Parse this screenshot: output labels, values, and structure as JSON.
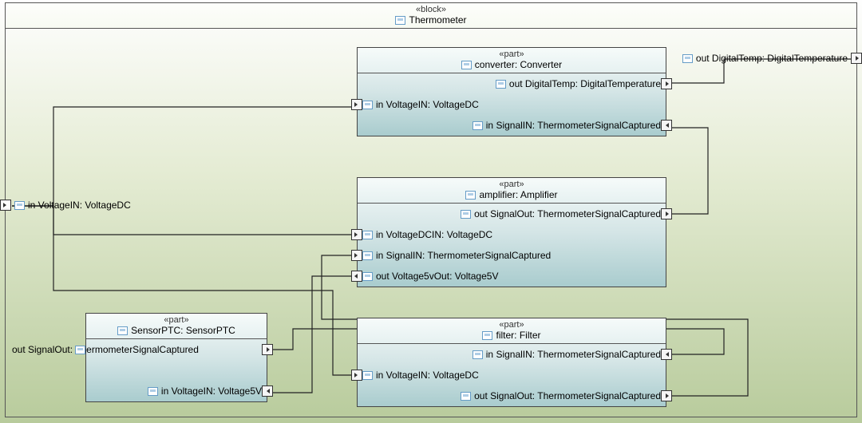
{
  "block": {
    "stereotype": "«block»",
    "name": "Thermometer",
    "outer_ports": {
      "voltageIn": {
        "label": "in VoltageIN: VoltageDC",
        "direction": "in",
        "side": "left"
      },
      "digitalTempOut": {
        "label": "out DigitalTemp: DigitalTemperature",
        "direction": "out",
        "side": "right"
      }
    }
  },
  "parts": {
    "converter": {
      "stereotype": "«part»",
      "name": "converter: Converter",
      "ports": {
        "digitalTempOut": {
          "label": "out DigitalTemp: DigitalTemperature",
          "direction": "out",
          "side": "right"
        },
        "voltageIn": {
          "label": "in VoltageIN: VoltageDC",
          "direction": "in",
          "side": "left"
        },
        "signalIn": {
          "label": "in SignalIN: ThermometerSignalCaptured",
          "direction": "in",
          "side": "right"
        }
      }
    },
    "amplifier": {
      "stereotype": "«part»",
      "name": "amplifier: Amplifier",
      "ports": {
        "signalOut": {
          "label": "out SignalOut: ThermometerSignalCaptured",
          "direction": "out",
          "side": "right"
        },
        "voltageDcIn": {
          "label": "in VoltageDCIN: VoltageDC",
          "direction": "in",
          "side": "left"
        },
        "signalIn": {
          "label": "in SignalIN: ThermometerSignalCaptured",
          "direction": "in",
          "side": "left"
        },
        "voltage5vOut": {
          "label": "out Voltage5vOut: Voltage5V",
          "direction": "out",
          "side": "left"
        }
      }
    },
    "sensor": {
      "stereotype": "«part»",
      "name": "SensorPTC: SensorPTC",
      "ports": {
        "signalOut": {
          "label": "out SignalOut: ThermometerSignalCaptured",
          "direction": "out",
          "side": "right"
        },
        "voltageIn": {
          "label": "in VoltageIN: Voltage5V",
          "direction": "in",
          "side": "right"
        }
      }
    },
    "filter": {
      "stereotype": "«part»",
      "name": "filter: Filter",
      "ports": {
        "signalIn": {
          "label": "in SignalIN: ThermometerSignalCaptured",
          "direction": "in",
          "side": "right"
        },
        "voltageIn": {
          "label": "in VoltageIN: VoltageDC",
          "direction": "in",
          "side": "left"
        },
        "signalOut": {
          "label": "out SignalOut: ThermometerSignalCaptured",
          "direction": "out",
          "side": "right"
        }
      }
    }
  },
  "connections": [
    {
      "from": "block.voltageIn",
      "to": "converter.voltageIn"
    },
    {
      "from": "block.voltageIn",
      "to": "amplifier.voltageDcIn"
    },
    {
      "from": "block.voltageIn",
      "to": "filter.voltageIn"
    },
    {
      "from": "converter.digitalTempOut",
      "to": "block.digitalTempOut"
    },
    {
      "from": "amplifier.signalOut",
      "to": "converter.signalIn"
    },
    {
      "from": "amplifier.voltage5vOut",
      "to": "sensor.voltageIn"
    },
    {
      "from": "sensor.signalOut",
      "to": "filter.signalIn"
    },
    {
      "from": "filter.signalOut",
      "to": "amplifier.signalIn"
    }
  ]
}
